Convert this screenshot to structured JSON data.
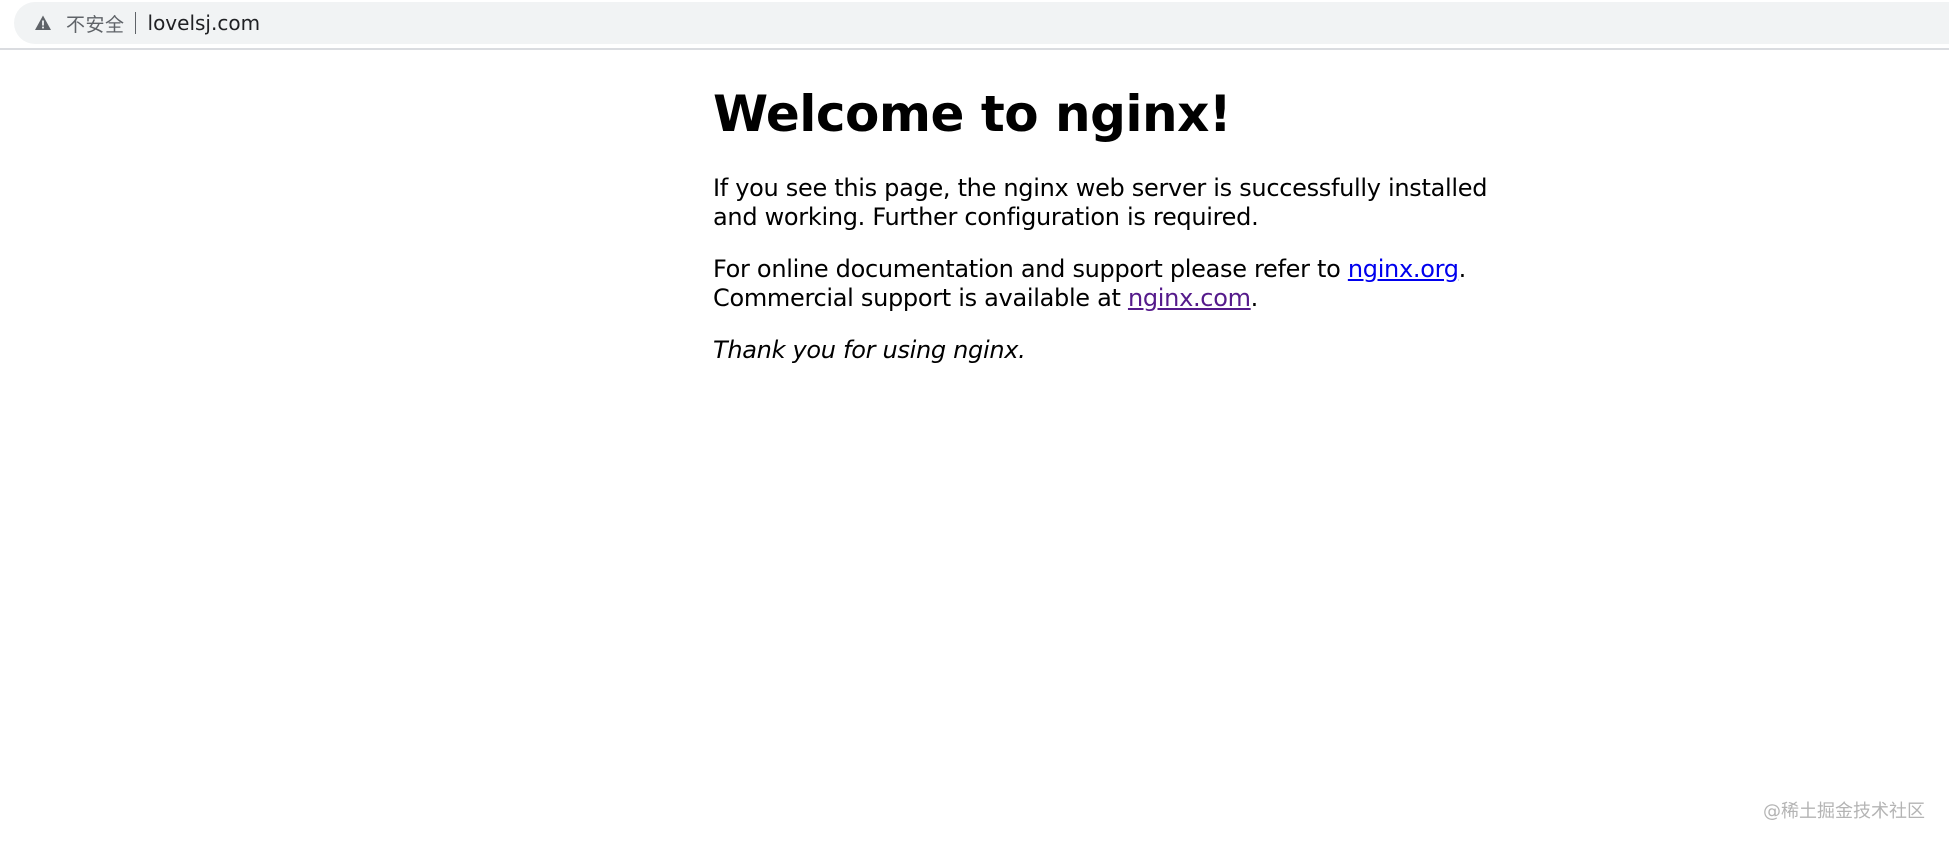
{
  "browser": {
    "security_label": "不安全",
    "url": "lovelsj.com",
    "icon": "warning-triangle-icon"
  },
  "page": {
    "heading": "Welcome to nginx!",
    "para1": "If you see this page, the nginx web server is successfully installed and working. Further configuration is required.",
    "para2_prefix": "For online documentation and support please refer to ",
    "link_org": "nginx.org",
    "para2_mid": ".",
    "para2_line2_prefix": "Commercial support is available at ",
    "link_com": "nginx.com",
    "para2_suffix": ".",
    "thanks": "Thank you for using nginx."
  },
  "watermark": "@稀土掘金技术社区",
  "colors": {
    "link": "#0000ee",
    "visited_link": "#551a8b"
  }
}
